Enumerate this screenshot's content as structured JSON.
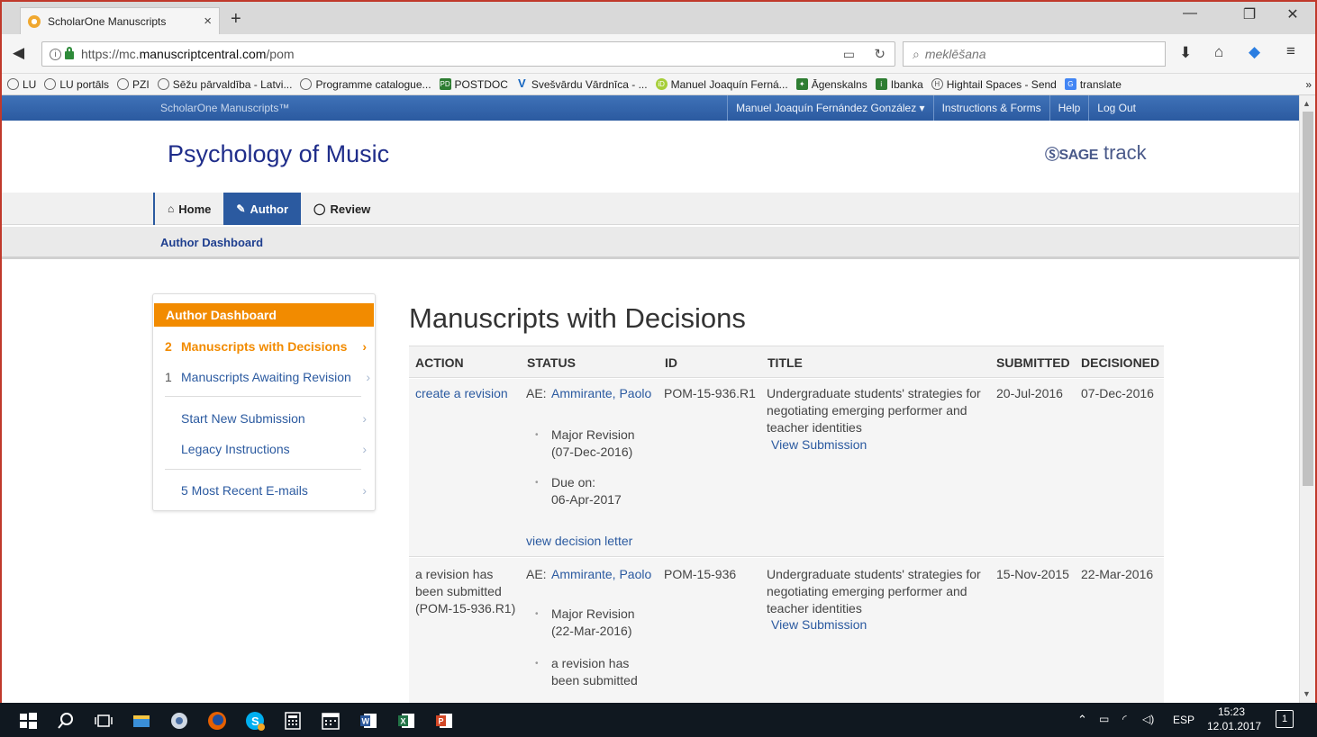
{
  "browser": {
    "tab_title": "ScholarOne Manuscripts",
    "tab_close": "×",
    "new_tab": "+",
    "url_prefix": "https://mc.",
    "url_domain": "manuscriptcentral.com",
    "url_path": "/pom",
    "search_placeholder": "meklēšana",
    "bookmarks": [
      {
        "label": "LU",
        "icon": "globe-icon"
      },
      {
        "label": "LU portāls",
        "icon": "globe-icon"
      },
      {
        "label": "PZI",
        "icon": "globe-icon"
      },
      {
        "label": "Sēžu pārvaldība - Latvi...",
        "icon": "globe-icon"
      },
      {
        "label": "Programme catalogue...",
        "icon": "globe-icon"
      },
      {
        "label": "POSTDOC",
        "icon": "postdoc-icon"
      },
      {
        "label": "Svešvārdu Vārdnīca - ...",
        "icon": "v-icon"
      },
      {
        "label": "Manuel Joaquín Ferná...",
        "icon": "orcid-icon"
      },
      {
        "label": "Āgenskalns",
        "icon": "shield-icon"
      },
      {
        "label": "Ibanka",
        "icon": "ibanka-icon"
      },
      {
        "label": "Hightail Spaces - Send",
        "icon": "hightail-icon"
      },
      {
        "label": "translate",
        "icon": "translate-icon"
      }
    ],
    "bookmarks_more": "»"
  },
  "s1": {
    "brand": "ScholarOne Manuscripts™",
    "user": "Manuel Joaquín Fernández González ▾",
    "instructions": "Instructions & Forms",
    "help": "Help",
    "logout": "Log Out"
  },
  "header": {
    "journal": "Psychology of Music",
    "sage_prefix": "SAGE",
    "sage_suffix": "track"
  },
  "nav": {
    "tabs": [
      {
        "label": "Home",
        "icon": "home-icon"
      },
      {
        "label": "Author",
        "icon": "pencil-icon"
      },
      {
        "label": "Review",
        "icon": "comment-icon"
      }
    ],
    "breadcrumb": "Author Dashboard"
  },
  "sidebar": {
    "heading": "Author Dashboard",
    "items": [
      {
        "num": "2",
        "label": "Manuscripts with Decisions"
      },
      {
        "num": "1",
        "label": "Manuscripts Awaiting Revision"
      },
      {
        "num": "",
        "label": "Start New Submission"
      },
      {
        "num": "",
        "label": "Legacy Instructions"
      },
      {
        "num": "",
        "label": "5 Most Recent E-mails"
      }
    ]
  },
  "main": {
    "title": "Manuscripts with Decisions",
    "columns": [
      "ACTION",
      "STATUS",
      "ID",
      "TITLE",
      "SUBMITTED",
      "DECISIONED"
    ],
    "rows": [
      {
        "action": "create a revision",
        "ae_label": "AE:",
        "ae_name": "Ammirante, Paolo",
        "status_1a": "Major Revision",
        "status_1b": "(07-Dec-2016)",
        "status_2a": "Due on:",
        "status_2b": "06-Apr-2017",
        "decision_link": "view decision letter",
        "id": "POM-15-936.R1",
        "title_1": "Undergraduate students' strategies for",
        "title_2": "negotiating emerging performer and",
        "title_3": "teacher identities",
        "view": "View Submission",
        "submitted": "20-Jul-2016",
        "decisioned": "07-Dec-2016"
      },
      {
        "action_1": "a revision has",
        "action_2": "been submitted",
        "action_3": "(POM-15-936.R1)",
        "ae_label": "AE:",
        "ae_name": "Ammirante, Paolo",
        "status_1a": "Major Revision",
        "status_1b": "(22-Mar-2016)",
        "status_2a": "a revision has",
        "status_2b": "been submitted",
        "id": "POM-15-936",
        "title_1": "Undergraduate students' strategies for",
        "title_2": "negotiating emerging performer and",
        "title_3": "teacher identities",
        "view": "View Submission",
        "submitted": "15-Nov-2015",
        "decisioned": "22-Mar-2016"
      }
    ]
  },
  "taskbar": {
    "lang": "ESP",
    "time": "15:23",
    "date": "12.01.2017",
    "notif": "1"
  },
  "colors": {
    "accent": "#2b5aa0",
    "orange": "#f28b00",
    "journal": "#1f2d8a"
  }
}
